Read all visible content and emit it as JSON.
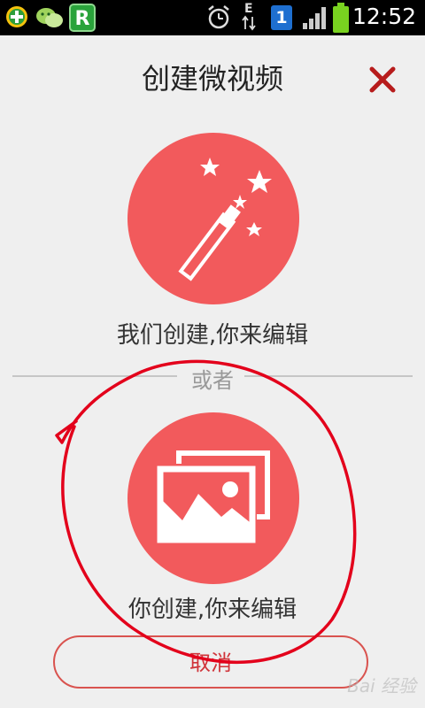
{
  "status_bar": {
    "time": "12:52",
    "network_type": "E",
    "notification_badge": "1",
    "icons": [
      "add-app-icon",
      "wechat-icon",
      "r-app-icon",
      "alarm-icon",
      "data-arrows-icon",
      "sim-badge-icon",
      "signal-icon",
      "battery-icon"
    ]
  },
  "header": {
    "title": "创建微视频"
  },
  "options": [
    {
      "label": "我们创建,你来编辑",
      "icon": "magic-wand-icon"
    },
    {
      "label": "你创建,你来编辑",
      "icon": "photo-gallery-icon"
    }
  ],
  "divider_text": "或者",
  "cancel_label": "取消",
  "watermark": "Bai 经验",
  "colors": {
    "accent": "#f25a5c",
    "close": "#b71c1c",
    "annotation": "#e3001b",
    "background": "#efefef"
  }
}
